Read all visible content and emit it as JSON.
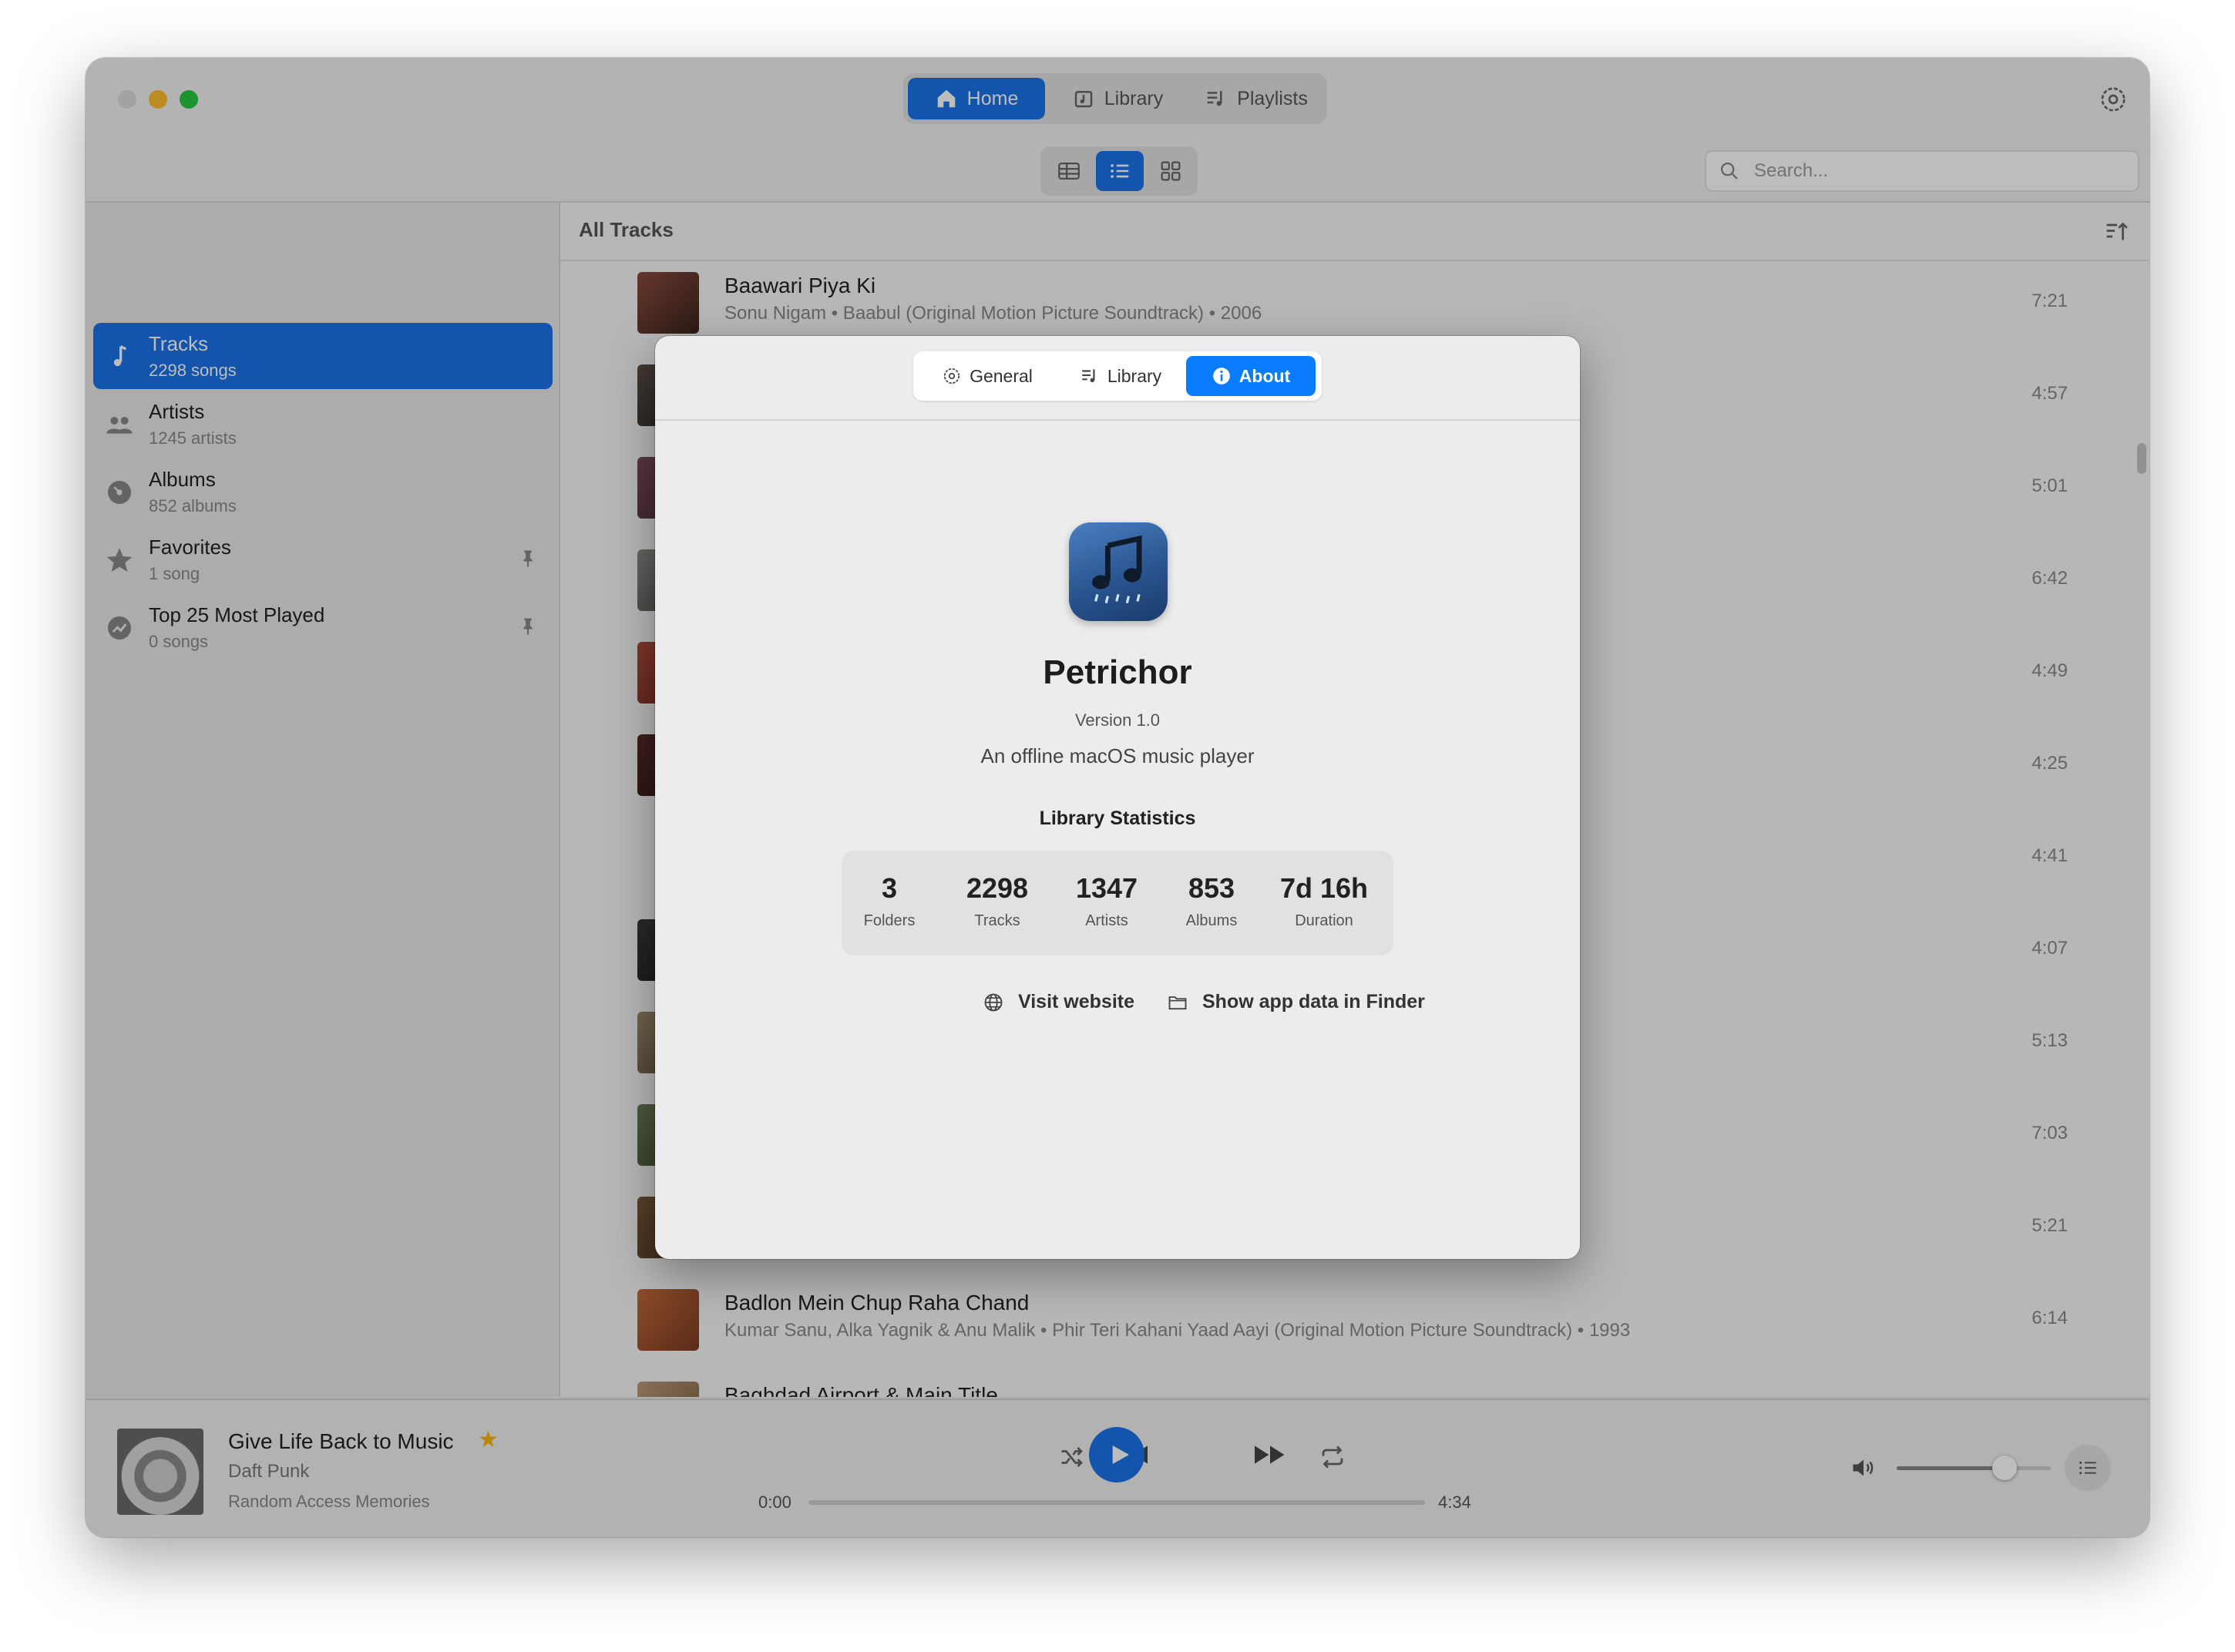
{
  "toolbar": {
    "tabs": [
      {
        "label": "Home",
        "icon": "home-icon"
      },
      {
        "label": "Library",
        "icon": "library-icon"
      },
      {
        "label": "Playlists",
        "icon": "playlist-icon"
      }
    ],
    "search_placeholder": "Search..."
  },
  "sidebar": {
    "items": [
      {
        "title": "Tracks",
        "subtitle": "2298 songs",
        "icon": "music-note-icon"
      },
      {
        "title": "Artists",
        "subtitle": "1245 artists",
        "icon": "people-icon"
      },
      {
        "title": "Albums",
        "subtitle": "852 albums",
        "icon": "vinyl-icon"
      },
      {
        "title": "Favorites",
        "subtitle": "1 song",
        "icon": "star-icon"
      },
      {
        "title": "Top 25 Most Played",
        "subtitle": "0 songs",
        "icon": "chart-icon"
      }
    ]
  },
  "main": {
    "title": "All Tracks",
    "rows": [
      {
        "title": "Baawari Piya Ki",
        "subtitle": "Sonu Nigam • Baabul (Original Motion Picture Soundtrack) • 2006",
        "duration": "7:21"
      },
      {
        "title": "",
        "subtitle": "",
        "duration": "4:57"
      },
      {
        "title": "",
        "subtitle": "",
        "duration": "5:01"
      },
      {
        "title": "",
        "subtitle": "",
        "duration": "6:42"
      },
      {
        "title": "",
        "subtitle": "",
        "duration": "4:49"
      },
      {
        "title": "",
        "subtitle": "",
        "duration": "4:25"
      },
      {
        "title": "",
        "subtitle": "",
        "duration": "4:41"
      },
      {
        "title": "",
        "subtitle": "",
        "duration": "4:07"
      },
      {
        "title": "",
        "subtitle": "",
        "duration": "5:13"
      },
      {
        "title": "",
        "subtitle": "",
        "duration": "7:03"
      },
      {
        "title": "",
        "subtitle": "",
        "duration": "5:21"
      },
      {
        "title": "Badlon Mein Chup Raha Chand",
        "subtitle": "Kumar Sanu, Alka Yagnik & Anu Malik • Phir Teri Kahani Yaad Aayi (Original Motion Picture Soundtrack) • 1993",
        "duration": "6:14"
      },
      {
        "title": "Baghdad Airport & Main Title",
        "subtitle": "",
        "duration": ""
      }
    ]
  },
  "player": {
    "title": "Give Life Back to Music",
    "artist": "Daft Punk",
    "album": "Random Access Memories",
    "elapsed": "0:00",
    "total": "4:34",
    "progress": 0,
    "volume": 0.7
  },
  "dialog": {
    "tabs": [
      {
        "label": "General",
        "icon": "gear-icon"
      },
      {
        "label": "Library",
        "icon": "library-icon"
      },
      {
        "label": "About",
        "icon": "info-icon"
      }
    ],
    "app_name": "Petrichor",
    "version": "Version 1.0",
    "description": "An offline macOS music player",
    "stats_title": "Library Statistics",
    "stats": [
      {
        "value": "3",
        "label": "Folders"
      },
      {
        "value": "2298",
        "label": "Tracks"
      },
      {
        "value": "1347",
        "label": "Artists"
      },
      {
        "value": "853",
        "label": "Albums"
      },
      {
        "value": "7d 16h",
        "label": "Duration"
      }
    ],
    "visit_website": "Visit website",
    "show_in_finder": "Show app data in Finder"
  },
  "colors": {
    "accent": "#0a7cff",
    "star": "#f5b800"
  }
}
